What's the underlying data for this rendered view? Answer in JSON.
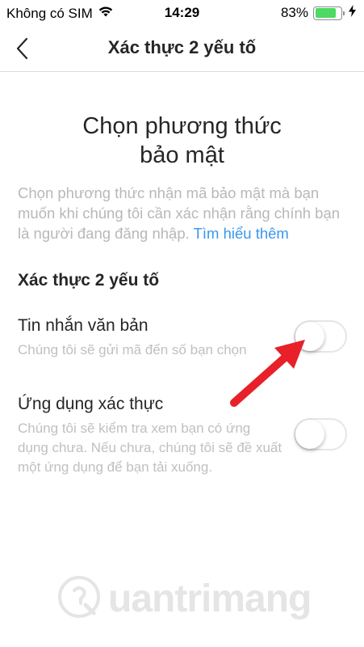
{
  "status_bar": {
    "carrier": "Không có SIM",
    "time": "14:29",
    "battery_percent": "83%",
    "battery_level": 0.83,
    "wifi_icon": "wifi-icon",
    "charging_icon": "bolt-icon",
    "battery_color": "#4cd964"
  },
  "nav": {
    "title": "Xác thực 2 yếu tố",
    "back_icon": "chevron-left-icon"
  },
  "main": {
    "heading_line1": "Chọn phương thức",
    "heading_line2": "bảo mật",
    "description": "Chọn phương thức nhận mã bảo mật mà bạn muốn khi chúng tôi cần xác nhận rằng chính bạn là người đang đăng nhập.",
    "learn_more": "Tìm hiểu thêm",
    "link_color": "#3897f0",
    "section_title": "Xác thực 2 yếu tố",
    "options": [
      {
        "title": "Tin nhắn văn bản",
        "description": "Chúng tôi sẽ gửi mã đến số bạn chọn",
        "enabled": false
      },
      {
        "title": "Ứng dụng xác thực",
        "description": "Chúng tôi sẽ kiểm tra xem bạn có ứng dụng chưa. Nếu chưa, chúng tôi sẽ đề xuất một ứng dụng để bạn tải xuống.",
        "enabled": false
      }
    ]
  },
  "overlay": {
    "arrow_color": "#e8202a",
    "watermark": "uantrimang"
  }
}
